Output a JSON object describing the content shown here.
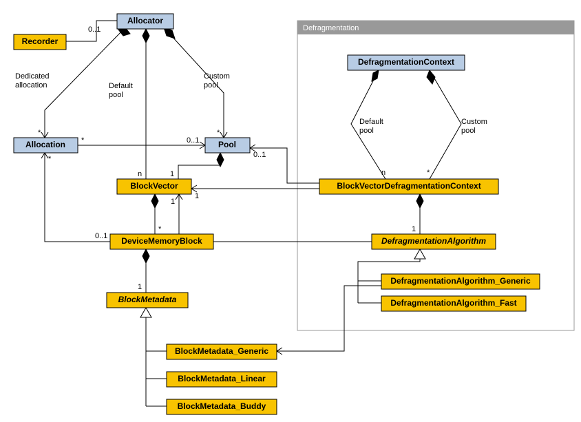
{
  "classes": {
    "allocator": "Allocator",
    "recorder": "Recorder",
    "allocation": "Allocation",
    "pool": "Pool",
    "blockVector": "BlockVector",
    "deviceMemoryBlock": "DeviceMemoryBlock",
    "blockMetadata": "BlockMetadata",
    "blockMetadataGeneric": "BlockMetadata_Generic",
    "blockMetadataLinear": "BlockMetadata_Linear",
    "blockMetadataBuddy": "BlockMetadata_Buddy",
    "defragContext": "DefragmentationContext",
    "bvDefragContext": "BlockVectorDefragmentationContext",
    "defragAlgorithm": "DefragmentationAlgorithm",
    "defragAlgGeneric": "DefragmentationAlgorithm_Generic",
    "defragAlgFast": "DefragmentationAlgorithm_Fast"
  },
  "frame": {
    "title": "Defragmentation"
  },
  "labels": {
    "dedicated": "Dedicated\nallocation",
    "defaultPool": "Default\npool",
    "customPool": "Custom\npool"
  },
  "mult": {
    "zeroOne": "0..1",
    "star": "*",
    "one": "1",
    "n": "n"
  },
  "chart_data": {
    "type": "table",
    "title": "UML class diagram – memory allocator",
    "classes": [
      {
        "name": "Allocator",
        "stereotype": "blue"
      },
      {
        "name": "Recorder",
        "stereotype": "gold"
      },
      {
        "name": "Allocation",
        "stereotype": "blue"
      },
      {
        "name": "Pool",
        "stereotype": "blue"
      },
      {
        "name": "BlockVector",
        "stereotype": "gold"
      },
      {
        "name": "DeviceMemoryBlock",
        "stereotype": "gold"
      },
      {
        "name": "BlockMetadata",
        "stereotype": "gold",
        "abstract": true
      },
      {
        "name": "BlockMetadata_Generic",
        "stereotype": "gold"
      },
      {
        "name": "BlockMetadata_Linear",
        "stereotype": "gold"
      },
      {
        "name": "BlockMetadata_Buddy",
        "stereotype": "gold"
      },
      {
        "name": "DefragmentationContext",
        "stereotype": "blue"
      },
      {
        "name": "BlockVectorDefragmentationContext",
        "stereotype": "gold"
      },
      {
        "name": "DefragmentationAlgorithm",
        "stereotype": "gold",
        "abstract": true
      },
      {
        "name": "DefragmentationAlgorithm_Generic",
        "stereotype": "gold"
      },
      {
        "name": "DefragmentationAlgorithm_Fast",
        "stereotype": "gold"
      }
    ],
    "relationships": [
      {
        "from": "Allocator",
        "to": "Recorder",
        "type": "composition",
        "mult_to": "0..1"
      },
      {
        "from": "Allocator",
        "to": "Allocation",
        "type": "composition",
        "label": "Dedicated allocation",
        "mult_to": "*"
      },
      {
        "from": "Allocator",
        "to": "BlockVector",
        "type": "composition",
        "label": "Default pool",
        "mult_to": "n"
      },
      {
        "from": "Allocator",
        "to": "Pool",
        "type": "composition",
        "label": "Custom pool",
        "mult_to": "*"
      },
      {
        "from": "Allocation",
        "to": "Pool",
        "type": "association",
        "mult_from": "*",
        "mult_to": "0..1"
      },
      {
        "from": "Pool",
        "to": "BlockVector",
        "type": "composition",
        "mult_to": "1"
      },
      {
        "from": "BlockVector",
        "to": "DeviceMemoryBlock",
        "type": "composition",
        "mult_to": "*"
      },
      {
        "from": "DeviceMemoryBlock",
        "to": "Allocation",
        "type": "association",
        "mult_from": "0..1",
        "mult_to": "*"
      },
      {
        "from": "DeviceMemoryBlock",
        "to": "BlockMetadata",
        "type": "composition",
        "mult_to": "1"
      },
      {
        "from": "BlockMetadata_Generic",
        "to": "BlockMetadata",
        "type": "generalization"
      },
      {
        "from": "BlockMetadata_Linear",
        "to": "BlockMetadata",
        "type": "generalization"
      },
      {
        "from": "BlockMetadata_Buddy",
        "to": "BlockMetadata",
        "type": "generalization"
      },
      {
        "from": "DefragmentationContext",
        "to": "BlockVectorDefragmentationContext",
        "type": "composition",
        "label": "Default pool",
        "mult_to": "n"
      },
      {
        "from": "DefragmentationContext",
        "to": "BlockVectorDefragmentationContext",
        "type": "composition",
        "label": "Custom pool",
        "mult_to": "*"
      },
      {
        "from": "BlockVectorDefragmentationContext",
        "to": "Pool",
        "type": "association",
        "mult_to": "0..1"
      },
      {
        "from": "BlockVectorDefragmentationContext",
        "to": "BlockVector",
        "type": "association",
        "mult_to": "1"
      },
      {
        "from": "BlockVectorDefragmentationContext",
        "to": "DefragmentationAlgorithm",
        "type": "composition",
        "mult_to": "1"
      },
      {
        "from": "DefragmentationAlgorithm",
        "to": "BlockVector",
        "type": "association",
        "mult_to": "1"
      },
      {
        "from": "DefragmentationAlgorithm_Generic",
        "to": "DefragmentationAlgorithm",
        "type": "generalization"
      },
      {
        "from": "DefragmentationAlgorithm_Fast",
        "to": "DefragmentationAlgorithm",
        "type": "generalization"
      },
      {
        "from": "DefragmentationAlgorithm_Generic",
        "to": "BlockMetadata_Generic",
        "type": "association"
      }
    ]
  }
}
